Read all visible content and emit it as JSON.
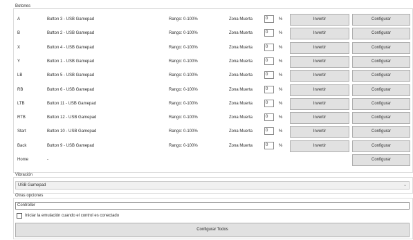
{
  "buttons_group": {
    "title": "Botones",
    "rows": [
      {
        "id": "a",
        "name": "A",
        "mapping": "Button 3 -  USB Gamepad",
        "range": "Rango: 0-100%",
        "deadzone_label": "Zona Muerta",
        "deadzone_value": "0",
        "percent": "%",
        "invert_label": "Invertir",
        "configure_label": "Configurar"
      },
      {
        "id": "b",
        "name": "B",
        "mapping": "Button 2 -  USB Gamepad",
        "range": "Rango: 0-100%",
        "deadzone_label": "Zona Muerta",
        "deadzone_value": "0",
        "percent": "%",
        "invert_label": "Invertir",
        "configure_label": "Configurar"
      },
      {
        "id": "x",
        "name": "X",
        "mapping": "Button 4 -  USB Gamepad",
        "range": "Rango: 0-100%",
        "deadzone_label": "Zona Muerta",
        "deadzone_value": "0",
        "percent": "%",
        "invert_label": "Invertir",
        "configure_label": "Configurar"
      },
      {
        "id": "y",
        "name": "Y",
        "mapping": "Button 1 -  USB Gamepad",
        "range": "Rango: 0-100%",
        "deadzone_label": "Zona Muerta",
        "deadzone_value": "0",
        "percent": "%",
        "invert_label": "Invertir",
        "configure_label": "Configurar"
      },
      {
        "id": "lb",
        "name": "LB",
        "mapping": "Button 5 -  USB Gamepad",
        "range": "Rango: 0-100%",
        "deadzone_label": "Zona Muerta",
        "deadzone_value": "0",
        "percent": "%",
        "invert_label": "Invertir",
        "configure_label": "Configurar"
      },
      {
        "id": "rb",
        "name": "RB",
        "mapping": "Button 6 -  USB Gamepad",
        "range": "Rango: 0-100%",
        "deadzone_label": "Zona Muerta",
        "deadzone_value": "0",
        "percent": "%",
        "invert_label": "Invertir",
        "configure_label": "Configurar"
      },
      {
        "id": "lth",
        "name": "LTB",
        "mapping": "Button 11 -  USB Gamepad",
        "range": "Rango: 0-100%",
        "deadzone_label": "Zona Muerta",
        "deadzone_value": "0",
        "percent": "%",
        "invert_label": "Invertir",
        "configure_label": "Configurar"
      },
      {
        "id": "rth",
        "name": "RTB",
        "mapping": "Button 12 -  USB Gamepad",
        "range": "Rango: 0-100%",
        "deadzone_label": "Zona Muerta",
        "deadzone_value": "0",
        "percent": "%",
        "invert_label": "Invertir",
        "configure_label": "Configurar"
      },
      {
        "id": "start",
        "name": "Start",
        "mapping": "Button 10 -  USB Gamepad",
        "range": "Rango: 0-100%",
        "deadzone_label": "Zona Muerta",
        "deadzone_value": "0",
        "percent": "%",
        "invert_label": "Invertir",
        "configure_label": "Configurar"
      },
      {
        "id": "back",
        "name": "Back",
        "mapping": "Button 9 -  USB Gamepad",
        "range": "Rango: 0-100%",
        "deadzone_label": "Zona Muerta",
        "deadzone_value": "0",
        "percent": "%",
        "invert_label": "Invertir",
        "configure_label": "Configurar"
      },
      {
        "id": "home",
        "name": "Home",
        "mapping": "-",
        "configure_label": "Configurar"
      }
    ]
  },
  "vibration": {
    "title": "Vibración",
    "selected": "USB Gamepad",
    "chevron_icon": "chevron-down-icon"
  },
  "other_options": {
    "title": "Otras opciones",
    "controller_name": "Controller",
    "start_on_connect_label": "Iniciar la emulación cuando el control es conectado",
    "start_on_connect_checked": false
  },
  "configure_all_label": "Configurar Todos"
}
